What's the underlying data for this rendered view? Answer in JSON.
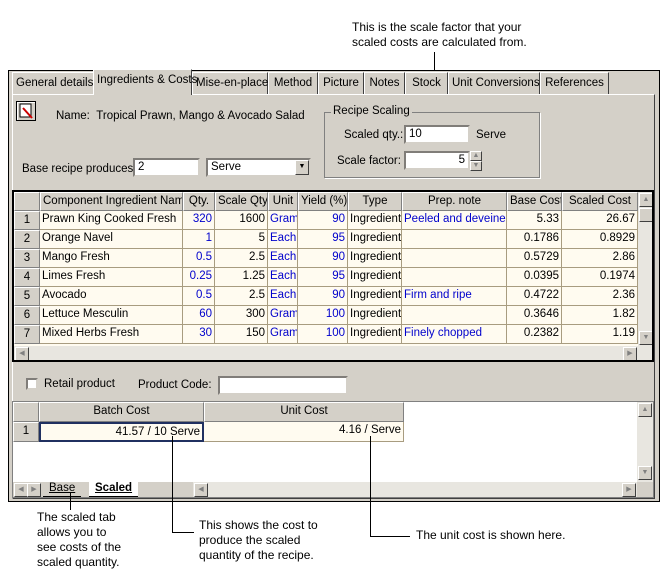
{
  "callouts": {
    "top": [
      "This is the scale factor that your",
      "scaled costs are calculated from."
    ],
    "scaled_tab": [
      "The scaled tab",
      "allows you to",
      "see costs of the",
      "scaled quantity."
    ],
    "batch": [
      "This shows the cost to",
      "produce the scaled",
      "quantity of the recipe."
    ],
    "unit": "The unit cost is shown here."
  },
  "tabs": [
    "General details",
    "Ingredients & Costs",
    "Mise-en-place",
    "Method",
    "Picture",
    "Notes",
    "Stock",
    "Unit Conversions",
    "References"
  ],
  "active_tab": "Ingredients & Costs",
  "recipe": {
    "name_label": "Name:",
    "name": "Tropical Prawn, Mango & Avocado Salad",
    "base_label": "Base recipe produces:",
    "base_qty": "2",
    "base_unit": "Serve"
  },
  "scaling": {
    "title": "Recipe Scaling",
    "scaled_qty_label": "Scaled qty.:",
    "scaled_qty": "10",
    "scaled_unit": "Serve",
    "factor_label": "Scale factor:",
    "factor": "5"
  },
  "grid": {
    "columns": [
      "",
      "Component Ingredient Name",
      "Qty.",
      "Scale Qty.",
      "Unit",
      "Yield (%)",
      "Type",
      "Prep. note",
      "Base Cost",
      "Scaled Cost"
    ],
    "rows": [
      [
        "1",
        "Prawn King Cooked Fresh",
        "320",
        "1600",
        "Gram",
        "90",
        "Ingredient",
        "Peeled and deveined",
        "5.33",
        "26.67"
      ],
      [
        "2",
        "Orange Navel",
        "1",
        "5",
        "Each",
        "95",
        "Ingredient",
        "",
        "0.1786",
        "0.8929"
      ],
      [
        "3",
        "Mango Fresh",
        "0.5",
        "2.5",
        "Each",
        "90",
        "Ingredient",
        "",
        "0.5729",
        "2.86"
      ],
      [
        "4",
        "Limes Fresh",
        "0.25",
        "1.25",
        "Each",
        "95",
        "Ingredient",
        "",
        "0.0395",
        "0.1974"
      ],
      [
        "5",
        "Avocado",
        "0.5",
        "2.5",
        "Each",
        "90",
        "Ingredient",
        "Firm and ripe",
        "0.4722",
        "2.36"
      ],
      [
        "6",
        "Lettuce Mesculin",
        "60",
        "300",
        "Gram",
        "100",
        "Ingredient",
        "",
        "0.3646",
        "1.82"
      ],
      [
        "7",
        "Mixed Herbs Fresh",
        "30",
        "150",
        "Gram",
        "100",
        "Ingredient",
        "Finely chopped",
        "0.2382",
        "1.19"
      ]
    ]
  },
  "retail": {
    "label": "Retail product",
    "checked": false,
    "code_label": "Product Code:",
    "code": ""
  },
  "costs": {
    "columns": [
      "",
      "Batch Cost",
      "Unit Cost"
    ],
    "rows": [
      [
        "1",
        "41.57 / 10 Serve",
        "4.16 / Serve"
      ]
    ]
  },
  "sheet_tabs": [
    "Base",
    "Scaled"
  ],
  "active_sheet": "Scaled"
}
